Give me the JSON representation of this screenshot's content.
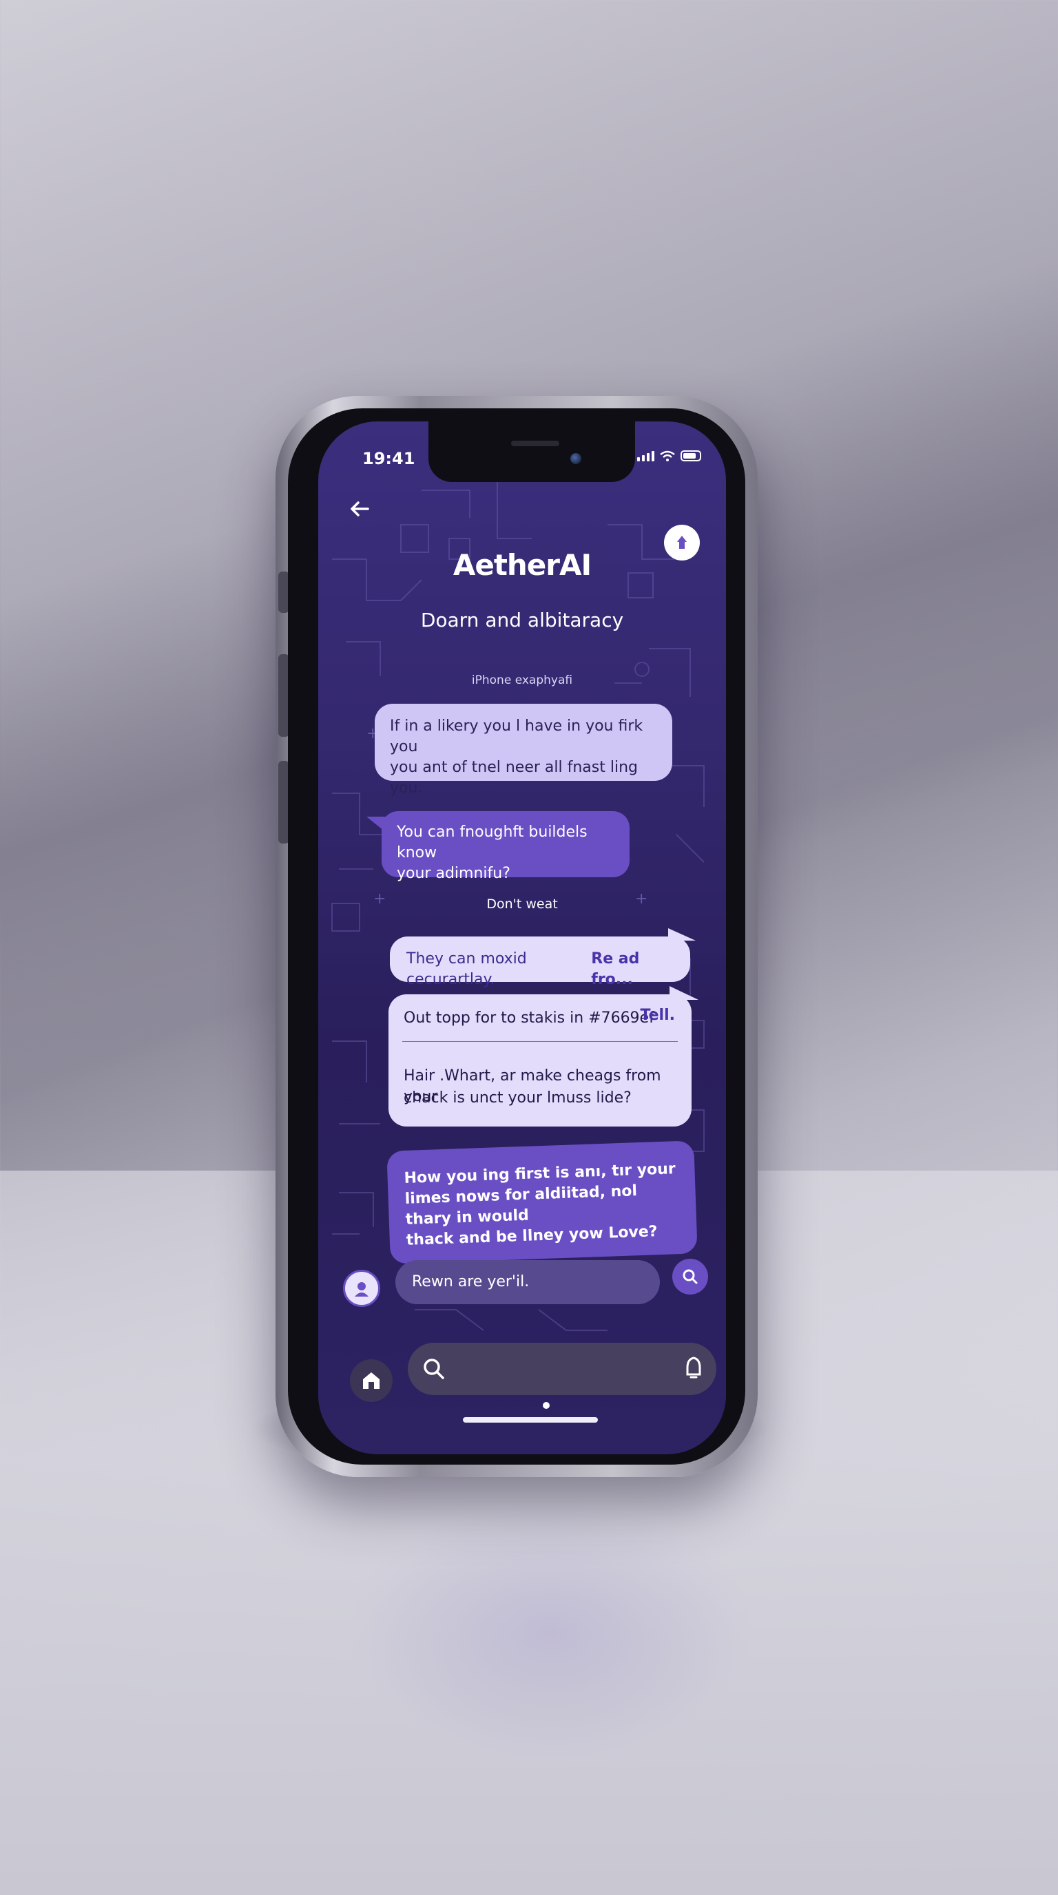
{
  "status_bar": {
    "time": "19:41"
  },
  "header": {
    "app_title": "AetherAI",
    "subtitle": "Doarn and albitaracy",
    "note": "iPhone exaphyafi"
  },
  "messages": [
    {
      "text_line1": "If in a likery you l have in you firk you",
      "text_line2": "you ant of tnel neer all fnast ling you."
    },
    {
      "text_line1": "You can fnoughft buildels know",
      "text_line2": "your adimnifu?"
    },
    {
      "separator": "Don't weat"
    },
    {
      "text": "They can moxid cecurartlay.",
      "link": "Re ad fro..."
    },
    {
      "text_line1": "Out topp for to stakis in #7669ef",
      "link": "Tell.",
      "text_line3": "Hair .Whart, ar make cheags from your",
      "text_line4": "chack is unct your lmuss lide?"
    },
    {
      "text_line1": "How you ing first is anı, tır your",
      "text_line2": "limes nows for aldiitad, nol thary in would",
      "text_line3": "thack and be llney yow Love?"
    }
  ],
  "composer": {
    "input_text": "Rewn are yer'il."
  },
  "bottom_bar": {
    "search_placeholder": ""
  },
  "colors": {
    "accent": "#6a4fc4",
    "background": "#34286f",
    "bubble_light": "#cfc6f5"
  }
}
